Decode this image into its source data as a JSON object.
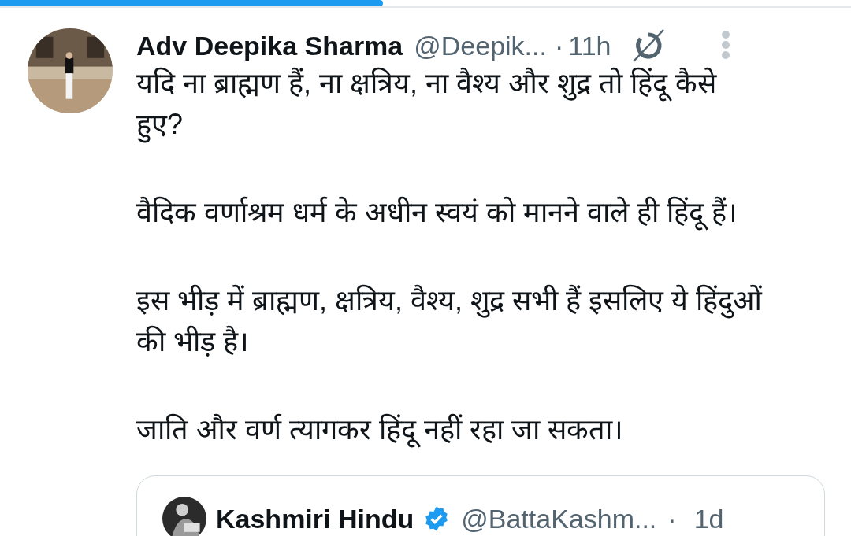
{
  "progress": {
    "level": 0.45
  },
  "tweet": {
    "author": "Adv Deepika Sharma",
    "handle": "@Deepik...",
    "separator": "·",
    "time": "11h",
    "paragraphs": [
      "यदि ना ब्राह्मण हैं, ना क्षत्रिय, ना वैश्य और शुद्र तो हिंदू कैसे हुए?",
      "वैदिक वर्णाश्रम धर्म के अधीन स्वयं को मानने वाले ही हिंदू हैं।",
      "इस भीड़ में ब्राह्मण, क्षत्रिय, वैश्य, शुद्र सभी हैं इसलिए ये हिंदुओं की भीड़ है।",
      "जाति और वर्ण त्यागकर हिंदू नहीं रहा जा सकता।"
    ]
  },
  "quoted": {
    "author": "Kashmiri Hindu",
    "verified": true,
    "handle": "@BattaKashm...",
    "separator": "·",
    "time": "1d"
  }
}
